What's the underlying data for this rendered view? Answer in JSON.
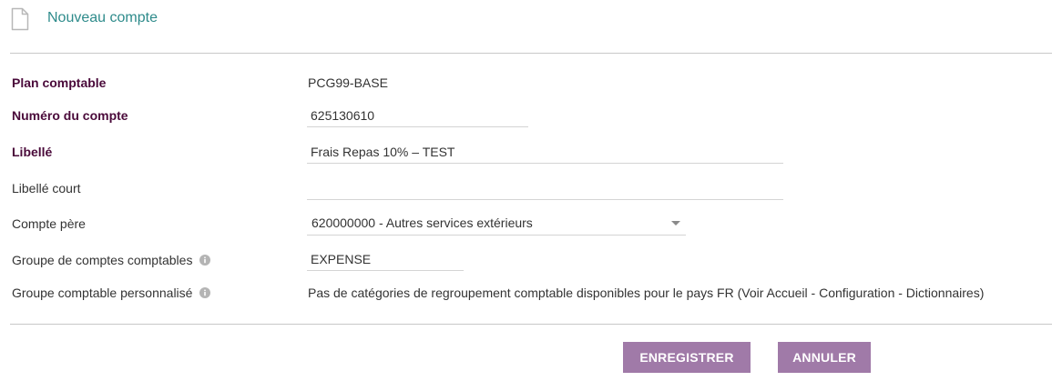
{
  "header": {
    "title": "Nouveau compte",
    "icon": "document-icon"
  },
  "form": {
    "plan": {
      "label": "Plan comptable",
      "value": "PCG99-BASE"
    },
    "account_number": {
      "label": "Numéro du compte",
      "value": "625130610"
    },
    "label_field": {
      "label": "Libellé",
      "value": "Frais Repas 10% – TEST"
    },
    "short_label": {
      "label": "Libellé court",
      "value": ""
    },
    "parent_account": {
      "label": "Compte père",
      "value": "620000000 - Autres services extérieurs"
    },
    "account_group": {
      "label": "Groupe de comptes comptables",
      "value": "EXPENSE",
      "icon": "info-icon"
    },
    "custom_group": {
      "label": "Groupe comptable personnalisé",
      "value": "Pas de catégories de regroupement comptable disponibles pour le pays FR (Voir Accueil - Configuration - Dictionnaires)",
      "icon": "info-icon"
    }
  },
  "buttons": {
    "save": "ENREGISTRER",
    "cancel": "ANNULER"
  },
  "colors": {
    "title": "#2e8b8b",
    "required_label": "#4a0a3a",
    "button": "#a07aa8",
    "divider": "#c8c8c8"
  }
}
